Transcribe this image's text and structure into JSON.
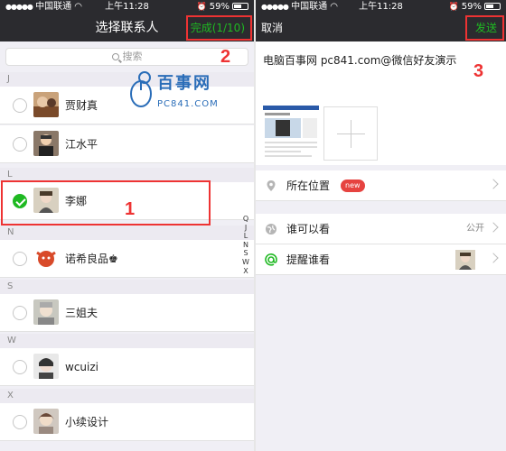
{
  "status": {
    "carrier": "中国联通",
    "time": "上午11:28",
    "battery": "59%"
  },
  "left": {
    "title": "选择联系人",
    "done_button": "完成(1/10)",
    "search_placeholder": "搜索",
    "sections": [
      {
        "letter": "J",
        "contacts": [
          {
            "name": "贾财真",
            "selected": false
          },
          {
            "name": "江水平",
            "selected": false
          }
        ]
      },
      {
        "letter": "L",
        "contacts": [
          {
            "name": "李娜",
            "selected": true
          }
        ]
      },
      {
        "letter": "N",
        "contacts": [
          {
            "name": "诺希良品♚",
            "selected": false
          }
        ]
      },
      {
        "letter": "S",
        "contacts": [
          {
            "name": "三姐夫",
            "selected": false
          }
        ]
      },
      {
        "letter": "W",
        "contacts": [
          {
            "name": "wcuizi",
            "selected": false
          }
        ]
      },
      {
        "letter": "X",
        "contacts": [
          {
            "name": "小续设计",
            "selected": false
          }
        ]
      }
    ],
    "index_letters": [
      "Q",
      "J",
      "L",
      "N",
      "S",
      "W",
      "X"
    ]
  },
  "watermark": {
    "text_cn": "百事网",
    "text_en": "PC841.COM"
  },
  "right": {
    "cancel_button": "取消",
    "send_button": "发送",
    "post_text": "电脑百事网 pc841.com@微信好友演示",
    "location_label": "所在位置",
    "location_badge": "new",
    "visibility_label": "谁可以看",
    "visibility_value": "公开",
    "remind_label": "提醒谁看"
  },
  "steps": {
    "step1": "1",
    "step2": "2",
    "step3": "3"
  },
  "colors": {
    "accent_green": "#1fb922",
    "annotation_red": "#e33333",
    "navbar_bg": "#2b2b2f"
  }
}
